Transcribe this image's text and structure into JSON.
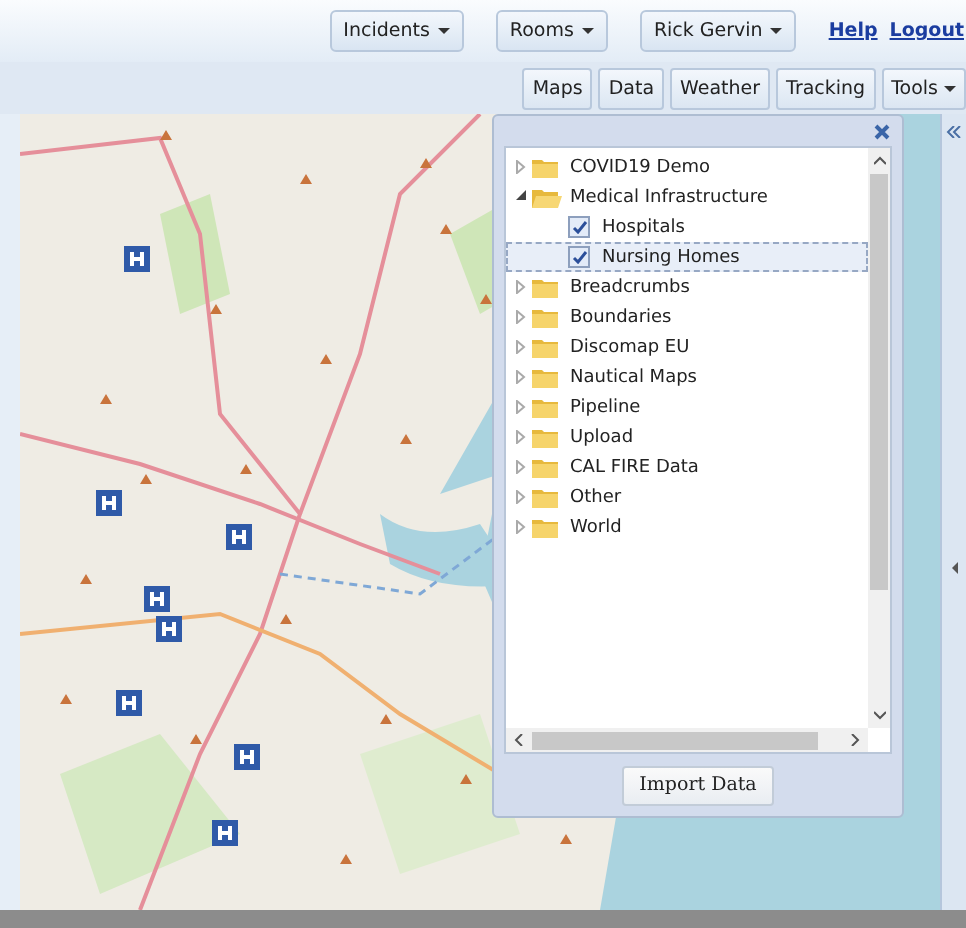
{
  "header": {
    "menus": [
      {
        "label": "Incidents"
      },
      {
        "label": "Rooms"
      },
      {
        "label": "Rick Gervin"
      }
    ],
    "links": [
      "Help",
      "Logout"
    ]
  },
  "toolbar": {
    "buttons": [
      {
        "label": "Maps",
        "kind": "plain"
      },
      {
        "label": "Data",
        "kind": "plain"
      },
      {
        "label": "Weather",
        "kind": "plain"
      },
      {
        "label": "Tracking",
        "kind": "plain"
      },
      {
        "label": "Tools",
        "kind": "menu"
      }
    ]
  },
  "layers_panel": {
    "tree": [
      {
        "label": "COVID19 Demo",
        "kind": "folder",
        "expanded": false,
        "selected": false
      },
      {
        "label": "Medical Infrastructure",
        "kind": "folder",
        "expanded": true,
        "selected": false,
        "children": [
          {
            "label": "Hospitals",
            "kind": "layer",
            "checked": true,
            "selected": false
          },
          {
            "label": "Nursing Homes",
            "kind": "layer",
            "checked": true,
            "selected": true
          }
        ]
      },
      {
        "label": "Breadcrumbs",
        "kind": "folder",
        "expanded": false,
        "selected": false
      },
      {
        "label": "Boundaries",
        "kind": "folder",
        "expanded": false,
        "selected": false
      },
      {
        "label": "Discomap EU",
        "kind": "folder",
        "expanded": false,
        "selected": false
      },
      {
        "label": "Nautical Maps",
        "kind": "folder",
        "expanded": false,
        "selected": false
      },
      {
        "label": "Pipeline",
        "kind": "folder",
        "expanded": false,
        "selected": false
      },
      {
        "label": "Upload",
        "kind": "folder",
        "expanded": false,
        "selected": false
      },
      {
        "label": "CAL FIRE Data",
        "kind": "folder",
        "expanded": false,
        "selected": false
      },
      {
        "label": "Other",
        "kind": "folder",
        "expanded": false,
        "selected": false
      },
      {
        "label": "World",
        "kind": "folder",
        "expanded": false,
        "selected": false
      }
    ],
    "import_button": "Import Data"
  }
}
